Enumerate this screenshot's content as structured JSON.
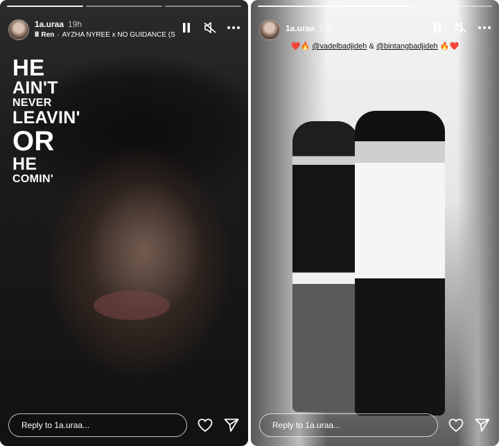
{
  "left_story": {
    "username": "1a.uraa",
    "time": "19h",
    "music": {
      "icon_text": "lll",
      "artist": "Ren",
      "separator": "·",
      "title": "AYZHA NYREE x NO GUIDANCE (S"
    },
    "lyrics": [
      "HE",
      "AIN'T",
      "NEVER",
      "LEAVIN'",
      "OR",
      "HE",
      "COMIN'"
    ],
    "reply_placeholder": "Reply to 1a.uraa...",
    "progress": {
      "total": 3,
      "completed": 1
    }
  },
  "right_story": {
    "username": "1a.uraa",
    "time": "13h",
    "mentions": {
      "lead": "❤️🔥",
      "mention_1": "@vadelbadjideh",
      "joiner": "&",
      "mention_2": "@bintangbadjideh",
      "trail": "🔥❤️"
    },
    "reply_placeholder": "Reply to 1a.uraa...",
    "progress": {
      "total": 3,
      "completed": 2
    }
  },
  "icons": {
    "pause": "pause-icon",
    "mute": "speaker-muted-icon",
    "more": "more-icon",
    "like": "heart-icon",
    "share": "send-icon"
  },
  "colors": {
    "text": "#ffffff",
    "mention": "#111111",
    "heart": "#d92c2c",
    "fire": "#f08a1b"
  }
}
